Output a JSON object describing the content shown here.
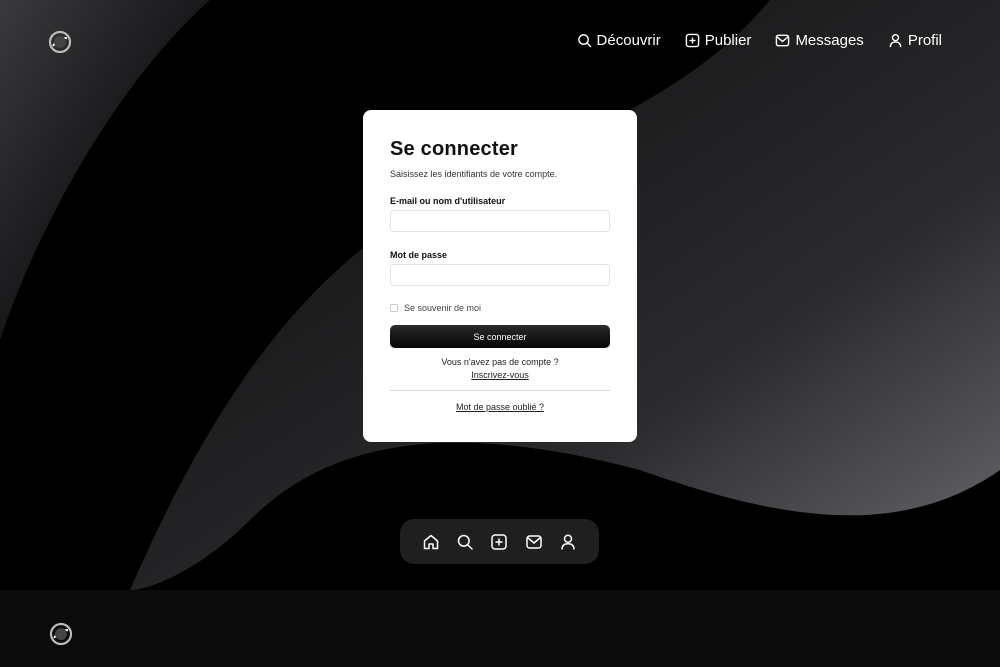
{
  "colors": {
    "background": "#000000",
    "card": "#ffffff",
    "button": "#111111",
    "dock": "#1f1f1f"
  },
  "header": {
    "logo_icon": "swirl-logo-icon",
    "nav": [
      {
        "label": "Découvrir",
        "icon": "search-icon"
      },
      {
        "label": "Publier",
        "icon": "plus-square-icon"
      },
      {
        "label": "Messages",
        "icon": "mail-icon"
      },
      {
        "label": "Profil",
        "icon": "user-icon"
      }
    ]
  },
  "login": {
    "title": "Se connecter",
    "subtitle": "Saisissez les identifiants de votre compte.",
    "username_label": "E-mail ou nom d'utilisateur",
    "username_value": "",
    "password_label": "Mot de passe",
    "password_value": "",
    "remember_label": "Se souvenir de moi",
    "remember_checked": false,
    "submit_label": "Se connecter",
    "no_account_text": "Vous n'avez pas de compte ?",
    "signup_link": "Inscrivez-vous",
    "forgot_link": "Mot de passe oublié ?"
  },
  "dock": {
    "items": [
      "home-icon",
      "search-icon",
      "plus-square-icon",
      "mail-icon",
      "user-icon"
    ]
  },
  "footer": {
    "logo_icon": "swirl-logo-icon"
  }
}
